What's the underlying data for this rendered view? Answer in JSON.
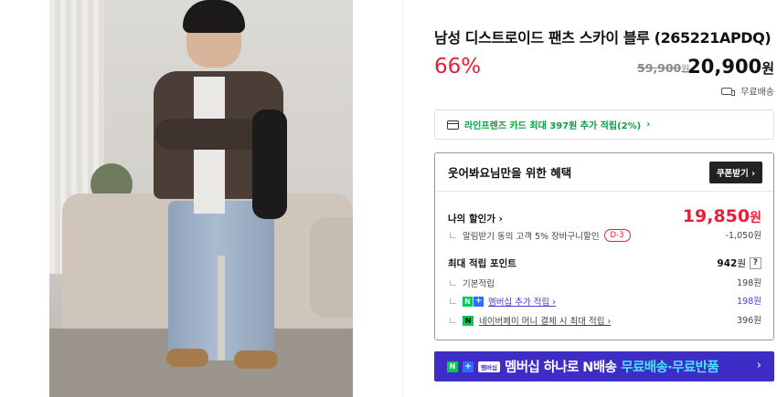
{
  "product": {
    "title": "남성 디스트로이드 팬츠 스카이 블루 (265221APDQ)",
    "discount_rate": "66%",
    "original_price": "59,900",
    "original_price_unit": "원",
    "sale_price": "20,900",
    "sale_price_unit": "원",
    "delivery_label": "무료배송"
  },
  "card_promo": {
    "text": "라인프렌즈 카드 최대 397원 추가 적립(2%)",
    "arrow": "›"
  },
  "benefit": {
    "title": "웃어봐요님만을 위한 혜택",
    "coupon_button": "쿠폰받기 ›",
    "my_price_label": "나의 할인가 ›",
    "my_price": "19,850",
    "my_price_unit": "원",
    "alarm_label": "알림받기 동의 고객 5% 장바구니할인",
    "dday": "D-3",
    "alarm_value": "-1,050원",
    "points_label": "최대 적립 포인트",
    "points_value": "942",
    "points_unit": "원",
    "points_help": "?",
    "base_label": "기본적립",
    "base_value": "198원",
    "membership_label": "멤버십 추가 적립 ›",
    "membership_value": "198원",
    "npay_label": "네이버페이 머니 결제 시 최대 적립 ›",
    "npay_value": "396원"
  },
  "banner": {
    "n_badge": "N",
    "plus_badge": "+",
    "member_tag": "멤버십",
    "text": "멤버십 하나로 N배송",
    "highlight": "무료배송·무료반품",
    "arrow": "›"
  },
  "colors": {
    "discount_red": "#e81f3a",
    "naver_green": "#03c75a",
    "membership_purple": "#3d2cc5",
    "banner_highlight": "#49e2ff"
  },
  "icons": [
    "truck-icon",
    "card-icon",
    "help-icon",
    "chevron-right-icon"
  ]
}
